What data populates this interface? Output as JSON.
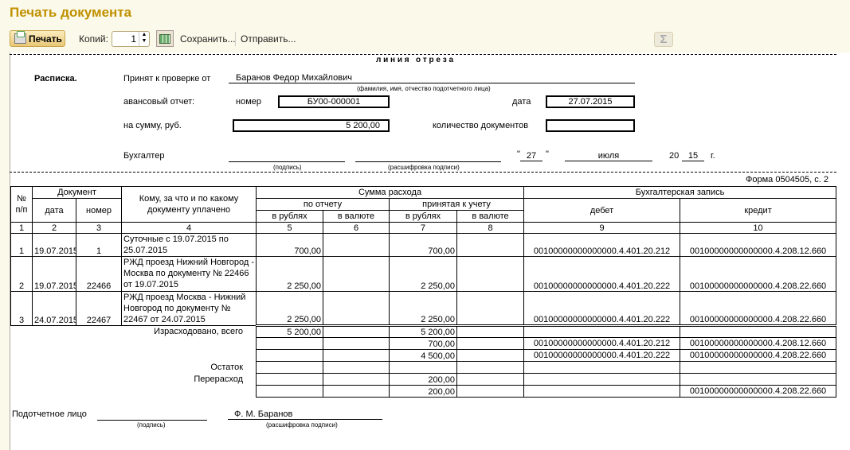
{
  "window": {
    "title": "Печать документа"
  },
  "toolbar": {
    "print_label": "Печать",
    "copies_label": "Копий:",
    "copies_value": "1",
    "save_label": "Сохранить...",
    "send_label": "Отправить...",
    "sum_label": "Σ"
  },
  "receipt": {
    "cut_line": "л и н и я   о т р е з а",
    "title": "Расписка.",
    "accepted_label": "Принят к проверке от",
    "person": "Баранов Федор Михайлович",
    "person_caption": "(фамилия, имя, отчество подотчетного лица)",
    "report_label": "авансовый отчет:",
    "number_label": "номер",
    "number": "БУ00-000001",
    "date_label": "дата",
    "date": "27.07.2015",
    "sum_label": "на сумму, руб.",
    "sum": "5 200,00",
    "docs_label": "количество документов",
    "docs": "",
    "accountant_label": "Бухгалтер",
    "sign_caption": "(подпись)",
    "decode_caption": "(расшифровка подписи)",
    "quote": "\"",
    "day": "27",
    "month": "июля",
    "year_prefix": "20",
    "year": "15",
    "year_suffix": "г."
  },
  "form_label": "Форма 0504505, с. 2",
  "table": {
    "headers": {
      "num": "№ п/п",
      "document": "Документ",
      "date": "дата",
      "number": "номер",
      "purpose": "Кому, за что и по какому документу уплачено",
      "sum": "Сумма расхода",
      "by_report": "по отчету",
      "accepted": "принятая к учету",
      "rub": "в рублях",
      "cur": "в валюте",
      "entry": "Бухгалтерская запись",
      "debit": "дебет",
      "credit": "кредит"
    },
    "col_numbers": [
      "1",
      "2",
      "3",
      "4",
      "5",
      "6",
      "7",
      "8",
      "9",
      "10"
    ],
    "rows": [
      [
        "1",
        "19.07.2015",
        "1",
        "Суточные с 19.07.2015 по 25.07.2015",
        "700,00",
        "",
        "700,00",
        "",
        "00100000000000000.4.401.20.212",
        "00100000000000000.4.208.12.660"
      ],
      [
        "2",
        "19.07.2015",
        "22466",
        "РЖД проезд Нижний Новгород - Москва по документу № 22466 от 19.07.2015",
        "2 250,00",
        "",
        "2 250,00",
        "",
        "00100000000000000.4.401.20.222",
        "00100000000000000.4.208.22.660"
      ],
      [
        "3",
        "24.07.2015",
        "22467",
        "РЖД проезд Москва - Нижний Новгород по документу № 22467 от 24.07.2015",
        "2 250,00",
        "",
        "2 250,00",
        "",
        "00100000000000000.4.401.20.222",
        "00100000000000000.4.208.22.660"
      ]
    ],
    "totals": [
      [
        "Израсходовано, всего",
        "5 200,00",
        "",
        "5 200,00",
        "",
        "",
        ""
      ],
      [
        "",
        "",
        "",
        "700,00",
        "",
        "00100000000000000.4.401.20.212",
        "00100000000000000.4.208.12.660"
      ],
      [
        "",
        "",
        "",
        "4 500,00",
        "",
        "00100000000000000.4.401.20.222",
        "00100000000000000.4.208.22.660"
      ],
      [
        "Остаток",
        "",
        "",
        "",
        "",
        "",
        ""
      ],
      [
        "Перерасход",
        "",
        "",
        "200,00",
        "",
        "",
        ""
      ],
      [
        "",
        "",
        "",
        "200,00",
        "",
        "",
        "00100000000000000.4.208.22.660"
      ]
    ]
  },
  "footer": {
    "person_label": "Подотчетное лицо",
    "sign_caption": "(подпись)",
    "name": "Ф. М. Баранов",
    "decode_caption": "(расшифровка подписи)"
  }
}
